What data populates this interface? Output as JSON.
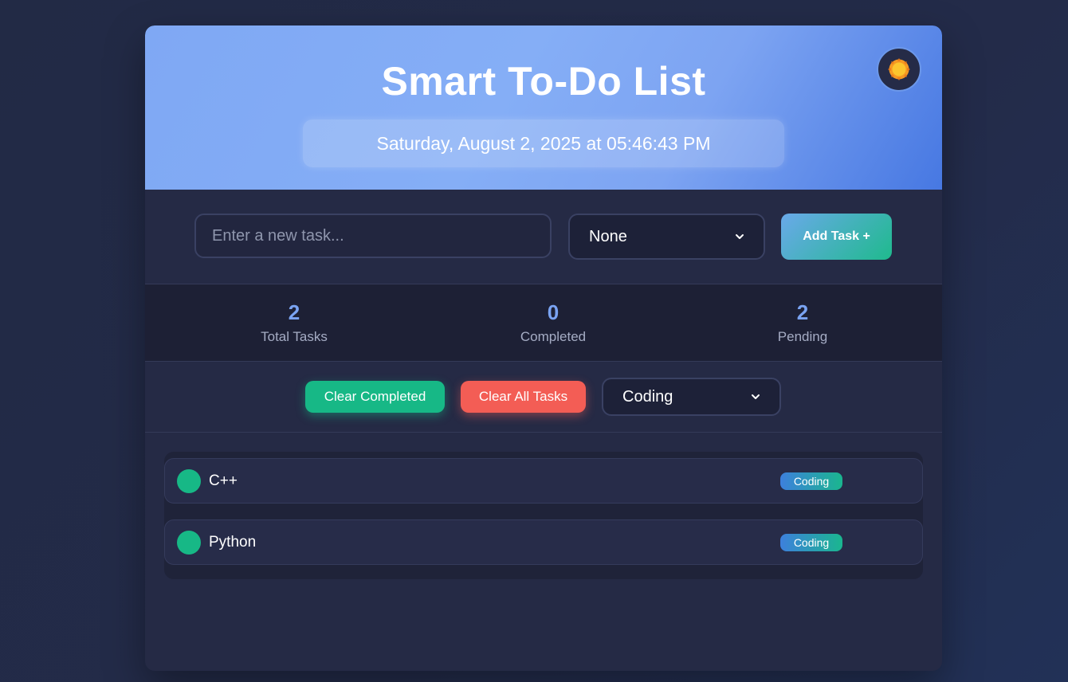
{
  "header": {
    "title": "Smart To-Do List",
    "datetime": "Saturday, August 2, 2025 at 05:46:43 PM",
    "theme_icon": "sun-icon"
  },
  "input_row": {
    "task_placeholder": "Enter a new task...",
    "task_value": "",
    "category_selected": "None",
    "add_button_label": "Add Task +"
  },
  "stats": {
    "total": {
      "value": "2",
      "label": "Total Tasks"
    },
    "completed": {
      "value": "0",
      "label": "Completed"
    },
    "pending": {
      "value": "2",
      "label": "Pending"
    }
  },
  "actions": {
    "clear_completed_label": "Clear Completed",
    "clear_all_label": "Clear All Tasks",
    "filter_selected": "Coding"
  },
  "tasks": [
    {
      "text": "C++",
      "category": "Coding"
    },
    {
      "text": "Python",
      "category": "Coding"
    }
  ],
  "colors": {
    "accent_green": "#17b886",
    "accent_red": "#f35d55",
    "accent_blue": "#7aa3f2",
    "background": "#232b49"
  }
}
